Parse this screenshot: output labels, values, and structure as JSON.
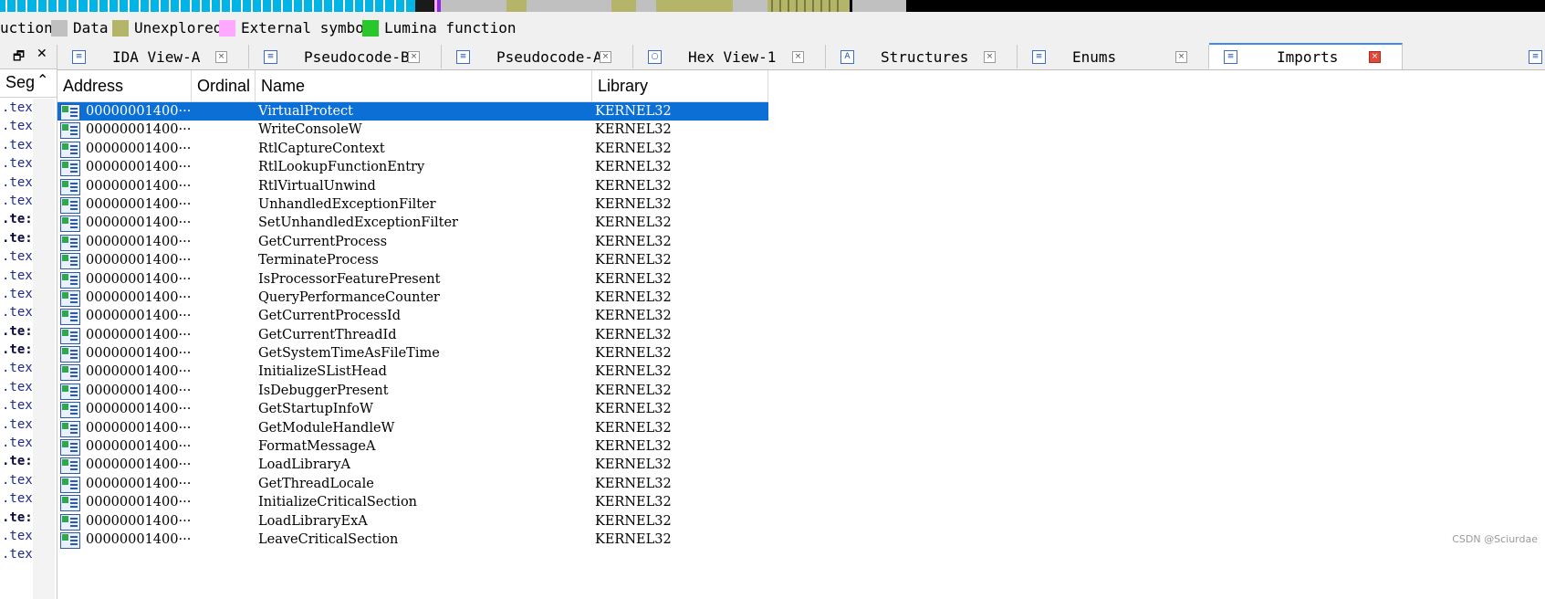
{
  "legend": {
    "items": [
      {
        "label": "uction",
        "color": ""
      },
      {
        "label": "Data",
        "color": "#c0c0c0"
      },
      {
        "label": "Unexplored",
        "color": "#b5b56a"
      },
      {
        "label": "External symbol",
        "color": "#ffa8ff"
      },
      {
        "label": "Lumina function",
        "color": "#29c829"
      }
    ]
  },
  "left_pane": {
    "header": "Seg",
    "restore_icon": "restore-window-icon",
    "close_icon": "close-icon",
    "rows": [
      ".tex",
      ".tex",
      ".tex",
      ".tex",
      ".tex",
      ".tex",
      ".te:",
      ".te:",
      ".tex",
      ".tex",
      ".tex",
      ".tex",
      ".te:",
      ".te:",
      ".tex",
      ".tex",
      ".tex",
      ".tex",
      ".tex",
      ".te:",
      ".tex",
      ".tex",
      ".te:",
      ".tex",
      ".tex"
    ],
    "bold_rows": [
      6,
      7,
      12,
      13,
      19,
      22
    ]
  },
  "tabs": [
    {
      "label": "IDA View-A",
      "icon": "ida-view-icon",
      "glyph": "≡"
    },
    {
      "label": "Pseudocode-B",
      "icon": "pseudocode-icon",
      "glyph": "≡"
    },
    {
      "label": "Pseudocode-A",
      "icon": "pseudocode-icon",
      "glyph": "≡"
    },
    {
      "label": "Hex View-1",
      "icon": "hex-view-icon",
      "glyph": "○"
    },
    {
      "label": "Structures",
      "icon": "structures-icon",
      "glyph": "A"
    },
    {
      "label": "Enums",
      "icon": "enums-icon",
      "glyph": "≡"
    },
    {
      "label": "Imports",
      "icon": "imports-icon",
      "glyph": "≡",
      "active": true
    }
  ],
  "columns": [
    "Address",
    "Ordinal",
    "Name",
    "Library"
  ],
  "rows": [
    {
      "address": "00000001400···",
      "ordinal": "",
      "name": "VirtualProtect",
      "library": "KERNEL32"
    },
    {
      "address": "00000001400···",
      "ordinal": "",
      "name": "WriteConsoleW",
      "library": "KERNEL32"
    },
    {
      "address": "00000001400···",
      "ordinal": "",
      "name": "RtlCaptureContext",
      "library": "KERNEL32"
    },
    {
      "address": "00000001400···",
      "ordinal": "",
      "name": "RtlLookupFunctionEntry",
      "library": "KERNEL32"
    },
    {
      "address": "00000001400···",
      "ordinal": "",
      "name": "RtlVirtualUnwind",
      "library": "KERNEL32"
    },
    {
      "address": "00000001400···",
      "ordinal": "",
      "name": "UnhandledExceptionFilter",
      "library": "KERNEL32"
    },
    {
      "address": "00000001400···",
      "ordinal": "",
      "name": "SetUnhandledExceptionFilter",
      "library": "KERNEL32"
    },
    {
      "address": "00000001400···",
      "ordinal": "",
      "name": "GetCurrentProcess",
      "library": "KERNEL32"
    },
    {
      "address": "00000001400···",
      "ordinal": "",
      "name": "TerminateProcess",
      "library": "KERNEL32"
    },
    {
      "address": "00000001400···",
      "ordinal": "",
      "name": "IsProcessorFeaturePresent",
      "library": "KERNEL32"
    },
    {
      "address": "00000001400···",
      "ordinal": "",
      "name": "QueryPerformanceCounter",
      "library": "KERNEL32"
    },
    {
      "address": "00000001400···",
      "ordinal": "",
      "name": "GetCurrentProcessId",
      "library": "KERNEL32"
    },
    {
      "address": "00000001400···",
      "ordinal": "",
      "name": "GetCurrentThreadId",
      "library": "KERNEL32"
    },
    {
      "address": "00000001400···",
      "ordinal": "",
      "name": "GetSystemTimeAsFileTime",
      "library": "KERNEL32"
    },
    {
      "address": "00000001400···",
      "ordinal": "",
      "name": "InitializeSListHead",
      "library": "KERNEL32"
    },
    {
      "address": "00000001400···",
      "ordinal": "",
      "name": "IsDebuggerPresent",
      "library": "KERNEL32"
    },
    {
      "address": "00000001400···",
      "ordinal": "",
      "name": "GetStartupInfoW",
      "library": "KERNEL32"
    },
    {
      "address": "00000001400···",
      "ordinal": "",
      "name": "GetModuleHandleW",
      "library": "KERNEL32"
    },
    {
      "address": "00000001400···",
      "ordinal": "",
      "name": "FormatMessageA",
      "library": "KERNEL32"
    },
    {
      "address": "00000001400···",
      "ordinal": "",
      "name": "LoadLibraryA",
      "library": "KERNEL32"
    },
    {
      "address": "00000001400···",
      "ordinal": "",
      "name": "GetThreadLocale",
      "library": "KERNEL32"
    },
    {
      "address": "00000001400···",
      "ordinal": "",
      "name": "InitializeCriticalSection",
      "library": "KERNEL32"
    },
    {
      "address": "00000001400···",
      "ordinal": "",
      "name": "LoadLibraryExA",
      "library": "KERNEL32"
    },
    {
      "address": "00000001400···",
      "ordinal": "",
      "name": "LeaveCriticalSection",
      "library": "KERNEL32"
    }
  ],
  "selected_row": 0,
  "watermark": "CSDN @Sciurdae",
  "colors": {
    "selection": "#0b6fd6",
    "code": "#00b4e6",
    "data": "#c0c0c0",
    "unexplored": "#b5b56a",
    "external": "#ffa8ff",
    "lumina": "#29c829"
  }
}
